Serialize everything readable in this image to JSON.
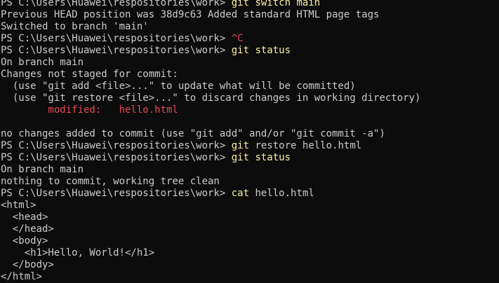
{
  "colors": {
    "background": "#0c0c0c",
    "text": "#cccccc",
    "command": "#f9f1a5",
    "error_red": "#e74856"
  },
  "prompt": "PS C:\\Users\\Huawei\\respositories\\work> ",
  "lines": [
    {
      "kind": "prompt",
      "cmd": "git switch main"
    },
    {
      "kind": "text",
      "text": "Previous HEAD position was 38d9c63 Added standard HTML page tags"
    },
    {
      "kind": "text",
      "text": "Switched to branch 'main'"
    },
    {
      "kind": "prompt_red",
      "cmd": "^C"
    },
    {
      "kind": "prompt",
      "cmd": "git status"
    },
    {
      "kind": "text",
      "text": "On branch main"
    },
    {
      "kind": "text",
      "text": "Changes not staged for commit:"
    },
    {
      "kind": "text",
      "text": "  (use \"git add <file>...\" to update what will be committed)"
    },
    {
      "kind": "text",
      "text": "  (use \"git restore <file>...\" to discard changes in working directory)"
    },
    {
      "kind": "red",
      "text": "        modified:   hello.html"
    },
    {
      "kind": "text",
      "text": ""
    },
    {
      "kind": "text",
      "text": "no changes added to commit (use \"git add\" and/or \"git commit -a\")"
    },
    {
      "kind": "prompt_mixed",
      "cmd": "git",
      "rest": " restore hello.html"
    },
    {
      "kind": "prompt",
      "cmd": "git status"
    },
    {
      "kind": "text",
      "text": "On branch main"
    },
    {
      "kind": "text",
      "text": "nothing to commit, working tree clean"
    },
    {
      "kind": "prompt_mixed",
      "cmd": "cat",
      "rest": " hello.html"
    },
    {
      "kind": "text",
      "text": "<html>"
    },
    {
      "kind": "text",
      "text": "  <head>"
    },
    {
      "kind": "text",
      "text": "  </head>"
    },
    {
      "kind": "text",
      "text": "  <body>"
    },
    {
      "kind": "text",
      "text": "    <h1>Hello, World!</h1>"
    },
    {
      "kind": "text",
      "text": "  </body>"
    },
    {
      "kind": "text",
      "text": "</html>"
    }
  ]
}
